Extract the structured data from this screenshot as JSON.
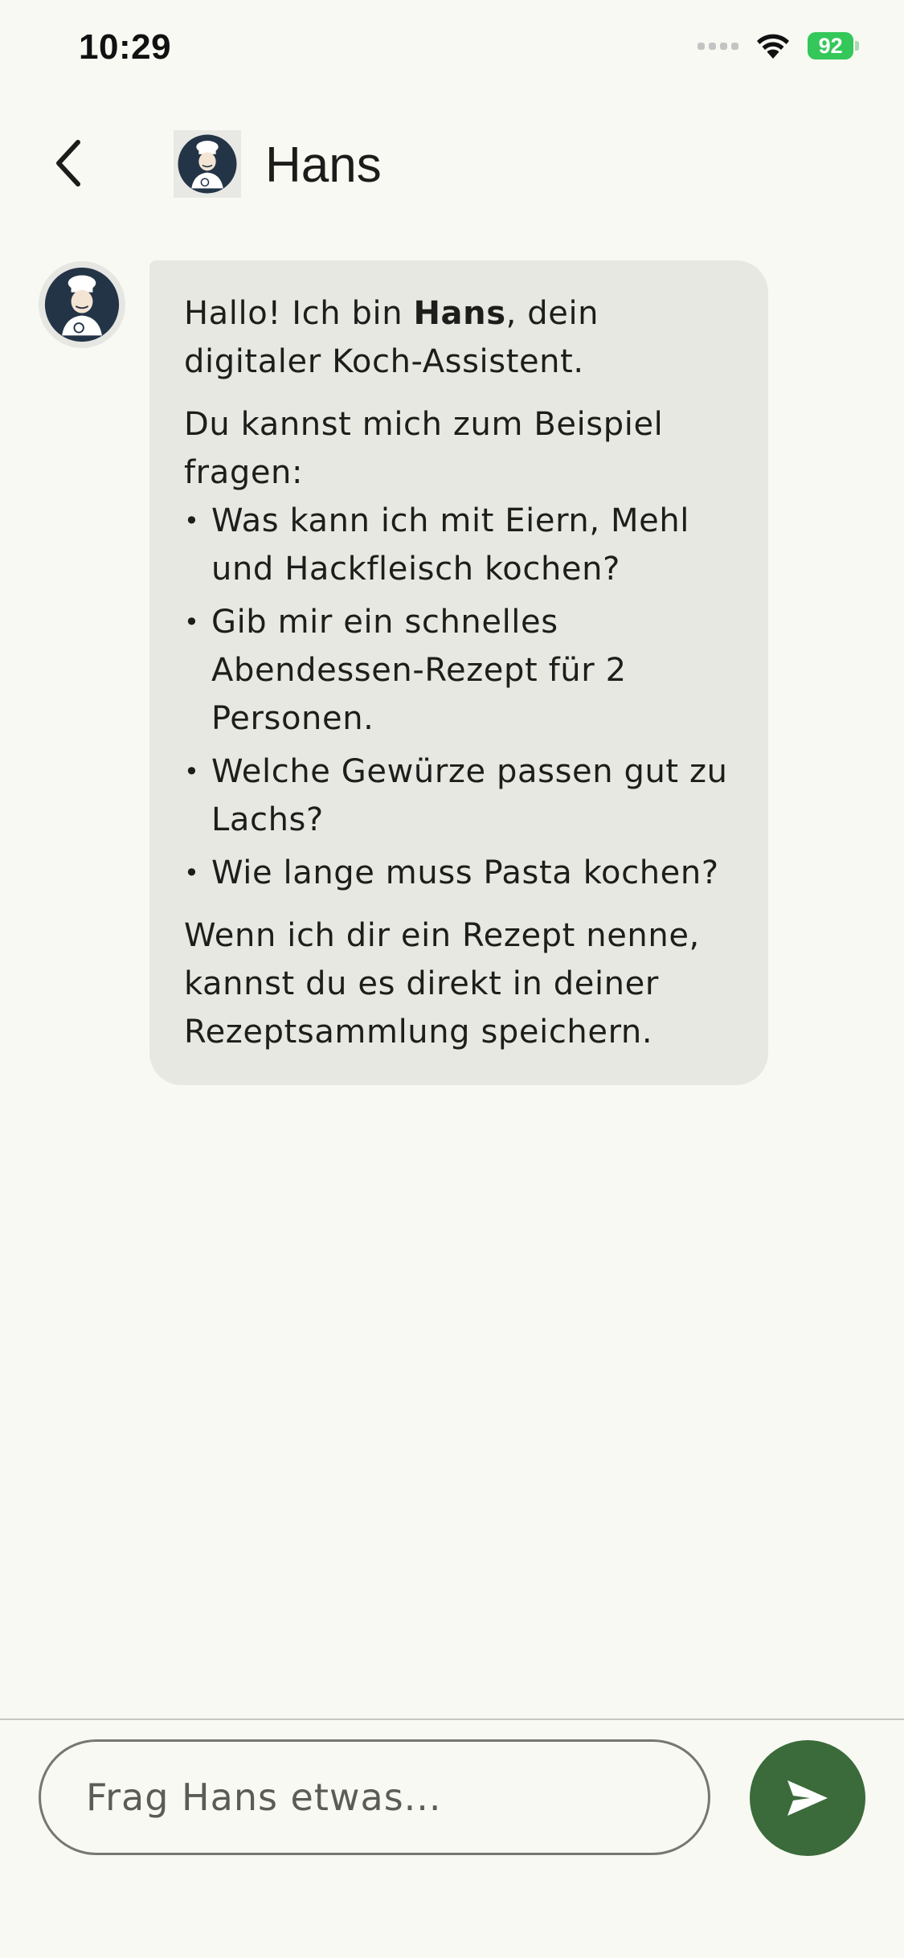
{
  "status_bar": {
    "time": "10:29",
    "battery": "92"
  },
  "header": {
    "title": "Hans",
    "avatar_icon": "chef-avatar-icon"
  },
  "message": {
    "greeting_prefix": "Hallo! Ich bin ",
    "greeting_name": "Hans",
    "greeting_suffix": ", dein digitaler Koch-Assistent.",
    "intro": "Du kannst mich zum Beispiel fragen:",
    "examples": [
      "Was kann ich mit Eiern, Mehl und Hackfleisch kochen?",
      "Gib mir ein schnelles Abendessen-Rezept für 2 Personen.",
      "Welche Gewürze passen gut zu Lachs?",
      "Wie lange muss Pasta kochen?"
    ],
    "outro": "Wenn ich dir ein Rezept nenne, kannst du es direkt in deiner Rezeptsammlung speichern."
  },
  "input": {
    "placeholder": "Frag Hans etwas..."
  },
  "colors": {
    "background": "#f7f9f2",
    "bubble": "#e8e8e2",
    "accent": "#3b6a3b",
    "battery": "#34c759"
  }
}
